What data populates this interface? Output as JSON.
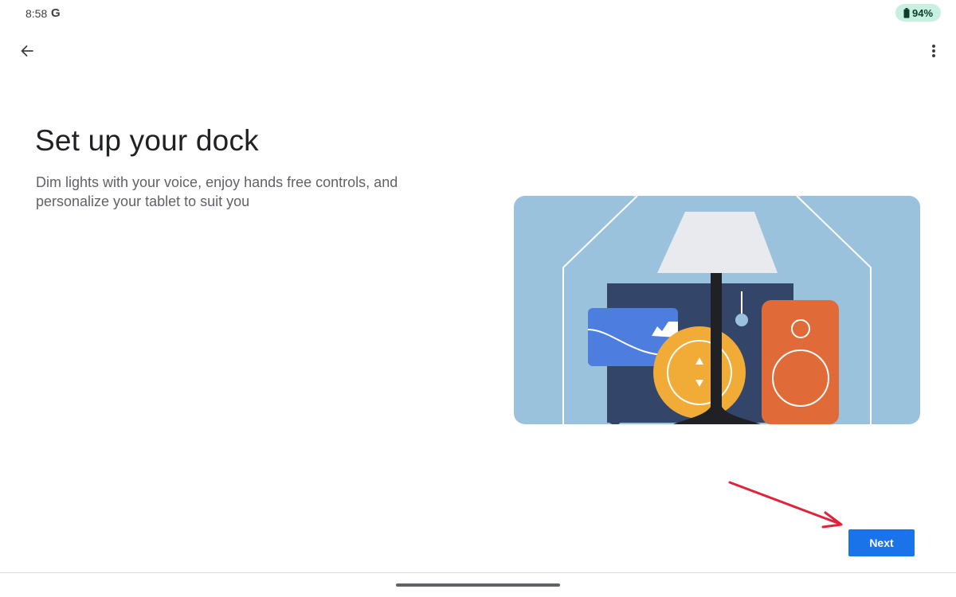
{
  "status_bar": {
    "time": "8:58",
    "google_logo": "G",
    "battery_percent": "94%",
    "battery_pill_color": "#c7f0df"
  },
  "toolbar": {
    "back_icon": "arrow-back-icon",
    "more_icon": "more-vert-icon"
  },
  "main": {
    "title": "Set up your dock",
    "description": "Dim lights with your voice, enjoy hands free controls, and personalize your tablet to suit you"
  },
  "illustration": {
    "icon": "smart-home-dock-illustration",
    "colors": {
      "background": "#9bc2dd",
      "tv": "#33466a",
      "picture": "#4e7de0",
      "lamp_shade": "#e8eaed",
      "lamp_pole": "#202124",
      "dial": "#f1ac38",
      "speaker": "#e06b38"
    }
  },
  "footer": {
    "next_label": "Next",
    "accent_color": "#1a73e8"
  },
  "annotation": {
    "arrow_color": "#e0223b"
  }
}
